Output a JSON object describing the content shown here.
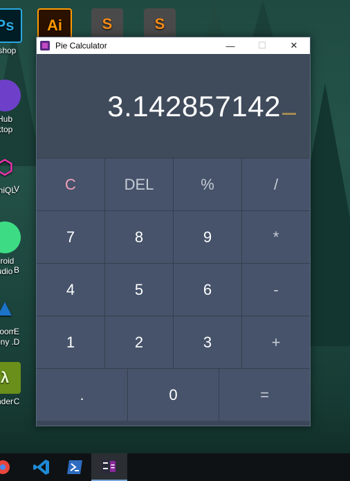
{
  "desktop": {
    "icons": [
      {
        "label": "oshop",
        "glyph": "Ps",
        "color": "#29a8e0"
      },
      {
        "label": "Ai",
        "glyph": "Ai",
        "color": "#ff9a00"
      },
      {
        "label": "",
        "glyph": "S",
        "color": "#f28a19"
      },
      {
        "label": "",
        "glyph": "S",
        "color": "#f28a19"
      },
      {
        "label": "Hub\nktop",
        "glyph": "",
        "color": "#6e40c9"
      },
      {
        "label": "phiQL",
        "glyph": "",
        "color": "#e535ab"
      },
      {
        "label": "V",
        "glyph": "",
        "color": ""
      },
      {
        "label": "droid\nudio",
        "glyph": "",
        "color": "#3ddc84"
      },
      {
        "label": "B",
        "glyph": "",
        "color": ""
      },
      {
        "label": "Boom\nhony ...",
        "glyph": "",
        "color": "#1c73c7"
      },
      {
        "label": "E\nD",
        "glyph": "",
        "color": ""
      },
      {
        "label": "nder",
        "glyph": "λ",
        "color": "#7fb800"
      },
      {
        "label": "C",
        "glyph": "",
        "color": ""
      }
    ]
  },
  "window": {
    "title": "Pie Calculator",
    "minimize": "—",
    "maximize": "☐",
    "close": "✕"
  },
  "calculator": {
    "display": "3.142857142",
    "rows": [
      [
        "C",
        "DEL",
        "%",
        "/"
      ],
      [
        "7",
        "8",
        "9",
        "*"
      ],
      [
        "4",
        "5",
        "6",
        "-"
      ],
      [
        "1",
        "2",
        "3",
        "+"
      ],
      [
        ".",
        "0",
        "="
      ]
    ]
  },
  "colors": {
    "accent": "#a48c52",
    "clear": "#f2a1b8",
    "key_bg": "#46536a",
    "display_bg": "#3f4a5b"
  },
  "taskbar": {
    "items": [
      "chrome-icon",
      "vscode-icon",
      "powershell-icon",
      "pie-calculator-icon"
    ]
  }
}
